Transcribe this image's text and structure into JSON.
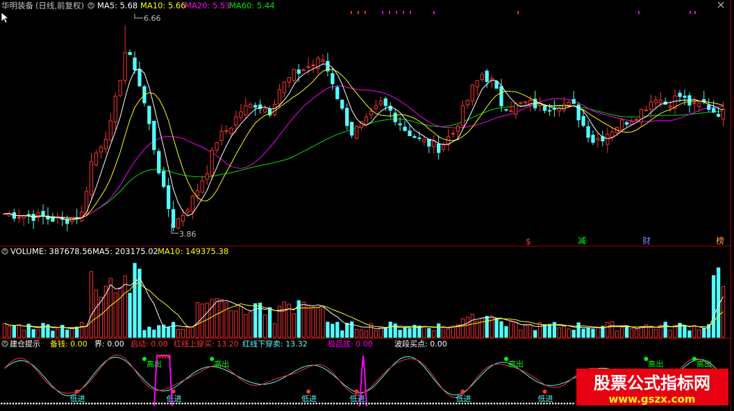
{
  "colors": {
    "up": "#ff3232",
    "down": "#54fcfc",
    "ma5": "#ffffff",
    "ma10": "#ffff00",
    "ma20": "#ff00ff",
    "ma60": "#00e000",
    "divider": "#a00000",
    "label": "#c0c0c0",
    "green_label": "#00ff00",
    "blue_label": "#8080ff",
    "orange_label": "#ffa040"
  },
  "main": {
    "title": "华明装备",
    "period": "(日线,前复权)",
    "ma5_label": "MA5: 5.68",
    "ma10_label": "MA10: 5.66",
    "ma20_label": "MA20: 5.53",
    "ma60_label": "MA60: 5.44",
    "high_label": "6.66",
    "low_label": "3.86",
    "markers": [
      {
        "text": "$",
        "color": "#ff3232"
      },
      {
        "text": "减",
        "color": "#00ff00"
      },
      {
        "text": "财",
        "color": "#8080ff"
      },
      {
        "text": "榜",
        "color": "#ffa040"
      }
    ]
  },
  "volume": {
    "volume_label": "VOLUME: 387678.56",
    "ma5_label": "MA5: 203175.02",
    "ma10_label": "MA10: 149375.38"
  },
  "indicator": {
    "title": "建仓提示",
    "items": [
      {
        "text": "备钱: 0.00",
        "color": "#ffff00"
      },
      {
        "text": "界: 0.00",
        "color": "#ffffff"
      },
      {
        "text": "启动: 0.00",
        "color": "#ff3232"
      },
      {
        "text": "红线上穿买: 13.20",
        "color": "#ff3232"
      },
      {
        "text": "红线下穿卖: 13.32",
        "color": "#54fcfc"
      },
      {
        "text": "极品底: 0.00",
        "color": "#ff00ff"
      },
      {
        "text": "波段买点: 0.00",
        "color": "#ffffff"
      }
    ],
    "buy_label": "低进",
    "sell_label": "高出"
  },
  "watermark": {
    "line1": "股票公式指标网",
    "line2": "www.gszx.com"
  },
  "chart_data": [
    {
      "type": "candlestick",
      "title": "华明装备",
      "series": [
        {
          "name": "MA5",
          "value": 5.68
        },
        {
          "name": "MA10",
          "value": 5.66
        },
        {
          "name": "MA20",
          "value": 5.53
        },
        {
          "name": "MA60",
          "value": 5.44
        }
      ],
      "annotations": [
        {
          "text": "6.66",
          "value": 6.66
        },
        {
          "text": "3.86",
          "value": 3.86
        }
      ],
      "ylim": [
        3.7,
        6.8
      ],
      "grid": false,
      "close_path": [
        [
          0,
          4.1
        ],
        [
          4,
          4.08
        ],
        [
          8,
          4.05
        ],
        [
          12,
          4.0
        ],
        [
          16,
          4.1
        ],
        [
          18,
          4.8
        ],
        [
          22,
          5.3
        ],
        [
          25,
          6.3
        ],
        [
          27,
          6.1
        ],
        [
          29,
          5.6
        ],
        [
          31,
          5.0
        ],
        [
          33,
          4.4
        ],
        [
          35,
          3.95
        ],
        [
          37,
          4.1
        ],
        [
          39,
          4.3
        ],
        [
          42,
          4.7
        ],
        [
          44,
          5.1
        ],
        [
          47,
          5.3
        ],
        [
          49,
          5.5
        ],
        [
          52,
          5.6
        ],
        [
          55,
          5.5
        ],
        [
          57,
          5.8
        ],
        [
          60,
          6.0
        ],
        [
          63,
          6.1
        ],
        [
          66,
          6.2
        ],
        [
          68,
          5.9
        ],
        [
          70,
          5.5
        ],
        [
          72,
          5.2
        ],
        [
          75,
          5.35
        ],
        [
          78,
          5.6
        ],
        [
          80,
          5.5
        ],
        [
          83,
          5.25
        ],
        [
          86,
          5.1
        ],
        [
          88,
          5.05
        ],
        [
          90,
          5.0
        ],
        [
          93,
          5.2
        ],
        [
          95,
          5.5
        ],
        [
          97,
          5.8
        ],
        [
          99,
          6.0
        ],
        [
          101,
          5.9
        ],
        [
          103,
          5.6
        ],
        [
          105,
          5.55
        ],
        [
          108,
          5.6
        ],
        [
          112,
          5.55
        ],
        [
          115,
          5.6
        ],
        [
          118,
          5.55
        ],
        [
          120,
          5.3
        ],
        [
          122,
          5.1
        ],
        [
          124,
          5.15
        ],
        [
          127,
          5.3
        ],
        [
          130,
          5.4
        ],
        [
          132,
          5.5
        ],
        [
          135,
          5.7
        ],
        [
          137,
          5.6
        ],
        [
          140,
          5.7
        ],
        [
          143,
          5.55
        ],
        [
          145,
          5.6
        ],
        [
          147,
          5.5
        ],
        [
          150,
          5.45
        ]
      ]
    },
    {
      "type": "bar",
      "title": "VOLUME",
      "series": [
        {
          "name": "VOLUME",
          "value": 387678.56
        },
        {
          "name": "MA5",
          "value": 203175.02
        },
        {
          "name": "MA10",
          "value": 149375.38
        }
      ]
    },
    {
      "type": "line",
      "title": "建仓提示",
      "series": [
        {
          "name": "备钱",
          "value": 0.0
        },
        {
          "name": "界",
          "value": 0.0
        },
        {
          "name": "启动",
          "value": 0.0
        },
        {
          "name": "红线上穿买",
          "value": 13.2
        },
        {
          "name": "红线下穿卖",
          "value": 13.32
        },
        {
          "name": "极品底",
          "value": 0.0
        },
        {
          "name": "波段买点",
          "value": 0.0
        }
      ],
      "sell_marks_at": [
        29,
        43,
        104,
        133,
        143
      ],
      "buy_marks_at": [
        15,
        35,
        63,
        73,
        95,
        112
      ]
    }
  ]
}
